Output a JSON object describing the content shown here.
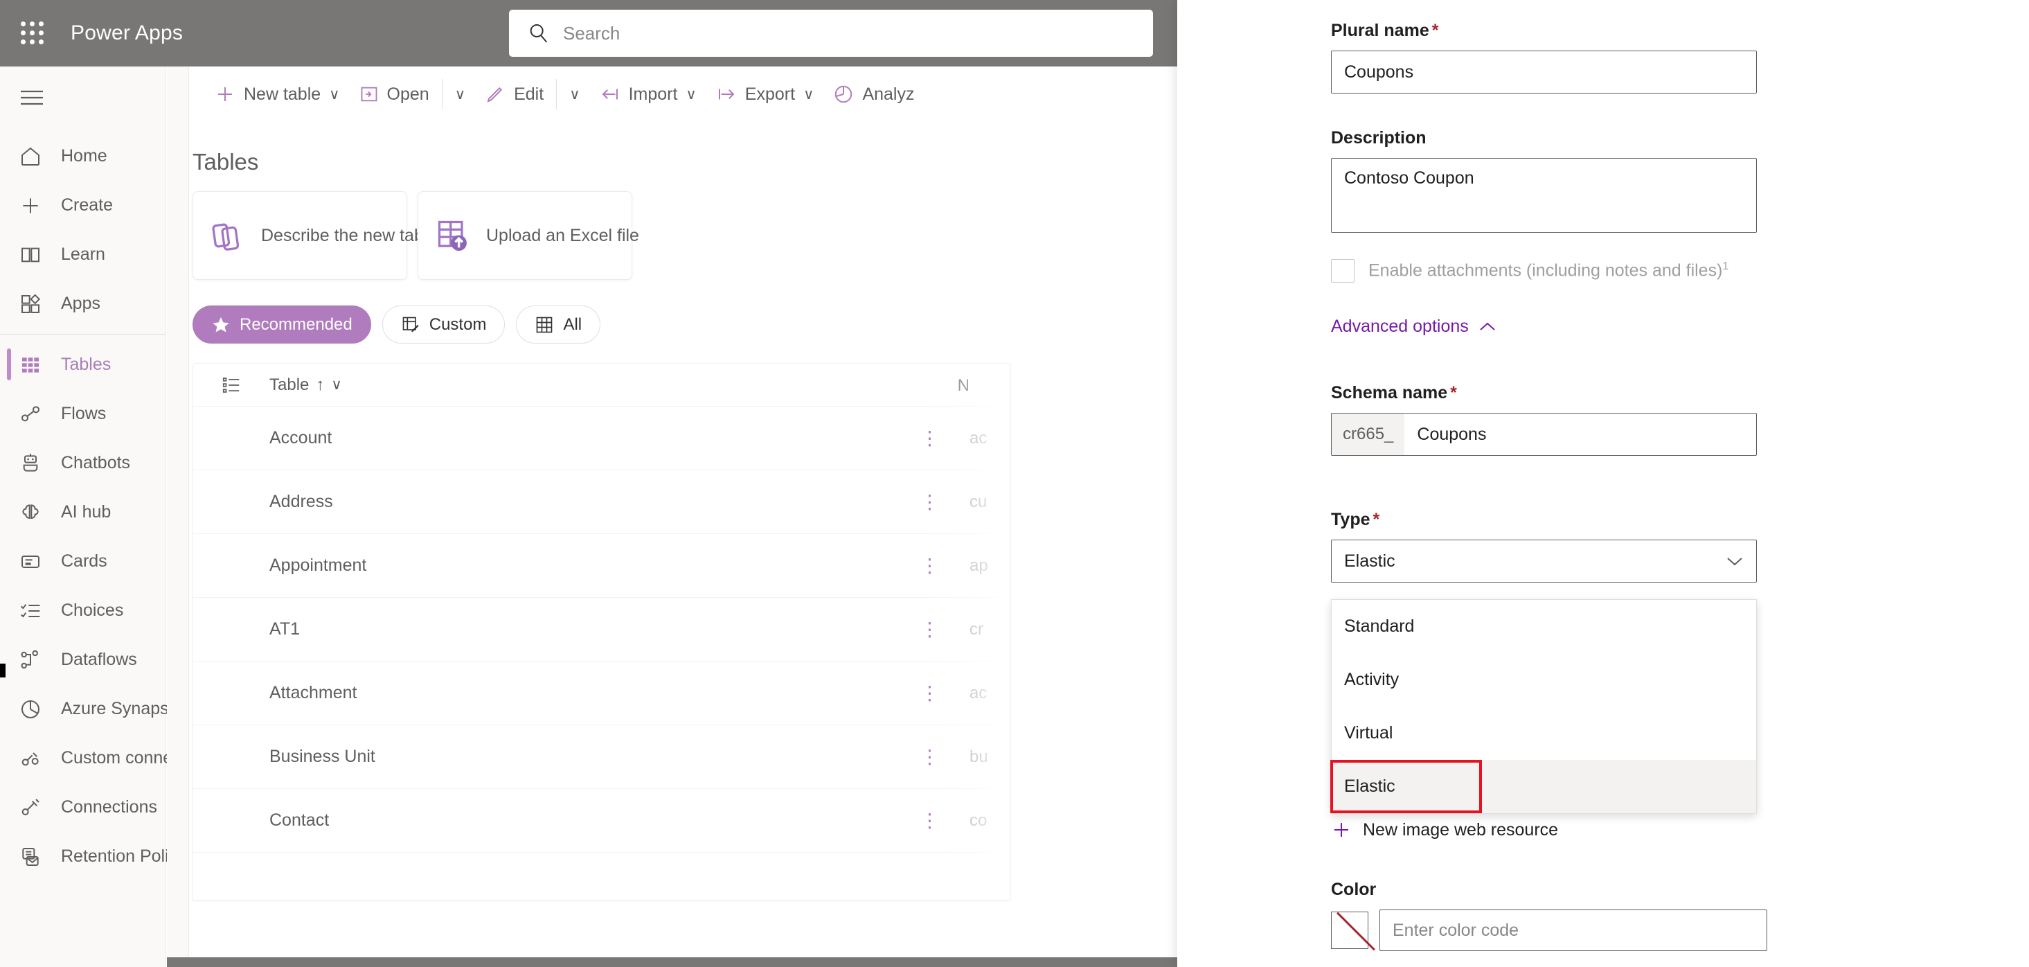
{
  "topbar": {
    "app_title": "Power Apps",
    "waffle_icon": "app-launcher-icon",
    "search_placeholder": "Search",
    "search_value": "",
    "search_icon": "search-icon"
  },
  "sidebar": {
    "hamburger_icon": "hamburger-menu-icon",
    "items": [
      {
        "label": "Home",
        "icon": "home-icon",
        "active": false
      },
      {
        "label": "Create",
        "icon": "plus-icon",
        "active": false
      },
      {
        "label": "Learn",
        "icon": "book-icon",
        "active": false
      },
      {
        "label": "Apps",
        "icon": "apps-grid-icon",
        "active": false
      },
      {
        "label": "Tables",
        "icon": "table-grid-icon",
        "active": true
      },
      {
        "label": "Flows",
        "icon": "flow-icon",
        "active": false
      },
      {
        "label": "Chatbots",
        "icon": "robot-icon",
        "active": false
      },
      {
        "label": "AI hub",
        "icon": "brain-icon",
        "active": false
      },
      {
        "label": "Cards",
        "icon": "card-icon",
        "active": false
      },
      {
        "label": "Choices",
        "icon": "checklist-icon",
        "active": false
      },
      {
        "label": "Dataflows",
        "icon": "dataflow-icon",
        "active": false
      },
      {
        "label": "Azure Synapse Link",
        "icon": "pie-chart-icon",
        "active": false
      },
      {
        "label": "Custom connectors",
        "icon": "plug-gear-icon",
        "active": false
      },
      {
        "label": "Connections",
        "icon": "plug-icon",
        "active": false
      },
      {
        "label": "Retention Policies",
        "icon": "archive-icon",
        "active": false
      }
    ]
  },
  "commandbar": {
    "buttons": [
      {
        "label": "New table",
        "icon": "plus-icon",
        "has_chevron": true,
        "sep_after": false
      },
      {
        "label": "Open",
        "icon": "open-icon",
        "has_chevron": false,
        "sep_after": true
      },
      {
        "label": "",
        "icon": "chevron-only",
        "has_chevron": true,
        "sep_after": false
      },
      {
        "label": "Edit",
        "icon": "pencil-icon",
        "has_chevron": false,
        "sep_after": true
      },
      {
        "label": "",
        "icon": "chevron-only",
        "has_chevron": true,
        "sep_after": false
      },
      {
        "label": "Import",
        "icon": "import-arrow-icon",
        "has_chevron": true,
        "sep_after": false
      },
      {
        "label": "Export",
        "icon": "export-arrow-icon",
        "has_chevron": true,
        "sep_after": false
      },
      {
        "label": "Analyz",
        "icon": "pie-chart-icon",
        "has_chevron": false,
        "sep_after": false
      }
    ]
  },
  "main": {
    "page_title": "Tables",
    "cards": [
      {
        "label": "Describe the new table",
        "icon": "describe-table-icon"
      },
      {
        "label": "Upload an Excel file",
        "icon": "upload-excel-icon"
      }
    ],
    "filter_pills": [
      {
        "label": "Recommended",
        "icon": "star-icon",
        "selected": true
      },
      {
        "label": "Custom",
        "icon": "custom-table-icon",
        "selected": false
      },
      {
        "label": "All",
        "icon": "all-table-icon",
        "selected": false
      }
    ],
    "grid": {
      "list_icon": "list-view-icon",
      "col_table": "Table",
      "sort_arrow": "↑",
      "col_name_partial": "N",
      "rows": [
        {
          "table": "Account",
          "schema": "ac"
        },
        {
          "table": "Address",
          "schema": "cu"
        },
        {
          "table": "Appointment",
          "schema": "ap"
        },
        {
          "table": "AT1",
          "schema": "cr"
        },
        {
          "table": "Attachment",
          "schema": "ac"
        },
        {
          "table": "Business Unit",
          "schema": "bu"
        },
        {
          "table": "Contact",
          "schema": "co"
        }
      ]
    }
  },
  "panel": {
    "plural_name": {
      "label": "Plural name",
      "required": true,
      "value": "Coupons"
    },
    "description": {
      "label": "Description",
      "value": "Contoso Coupon"
    },
    "enable_attachments": {
      "label": "Enable attachments (including notes and files)",
      "footnote": "1",
      "checked": false
    },
    "advanced_options": {
      "label": "Advanced options",
      "expanded": true,
      "chevron": "chevron-up-icon"
    },
    "schema_name": {
      "label": "Schema name",
      "required": true,
      "prefix": "cr665_",
      "value": "Coupons"
    },
    "type": {
      "label": "Type",
      "required": true,
      "selected": "Elastic",
      "open": true,
      "options": [
        "Standard",
        "Activity",
        "Virtual",
        "Elastic"
      ],
      "highlighted_option": "Elastic",
      "highlight_color": "#e81123"
    },
    "image_web_resource": {
      "value": "ro_rammer_disable.png, msdyn_/images...",
      "new_link_label": "New image web resource",
      "new_link_icon": "plus-icon"
    },
    "color": {
      "label": "Color",
      "swatch": "no-color-swatch",
      "placeholder": "Enter color code",
      "value": ""
    }
  },
  "colors": {
    "topbar_bg": "#797775",
    "accent_purple": "#b07cbd",
    "link_purple": "#7719aa",
    "required_red": "#a4262c",
    "highlight_red": "#e81123",
    "nav_bg": "#faf9f8",
    "text_grey": "#605e5c"
  }
}
